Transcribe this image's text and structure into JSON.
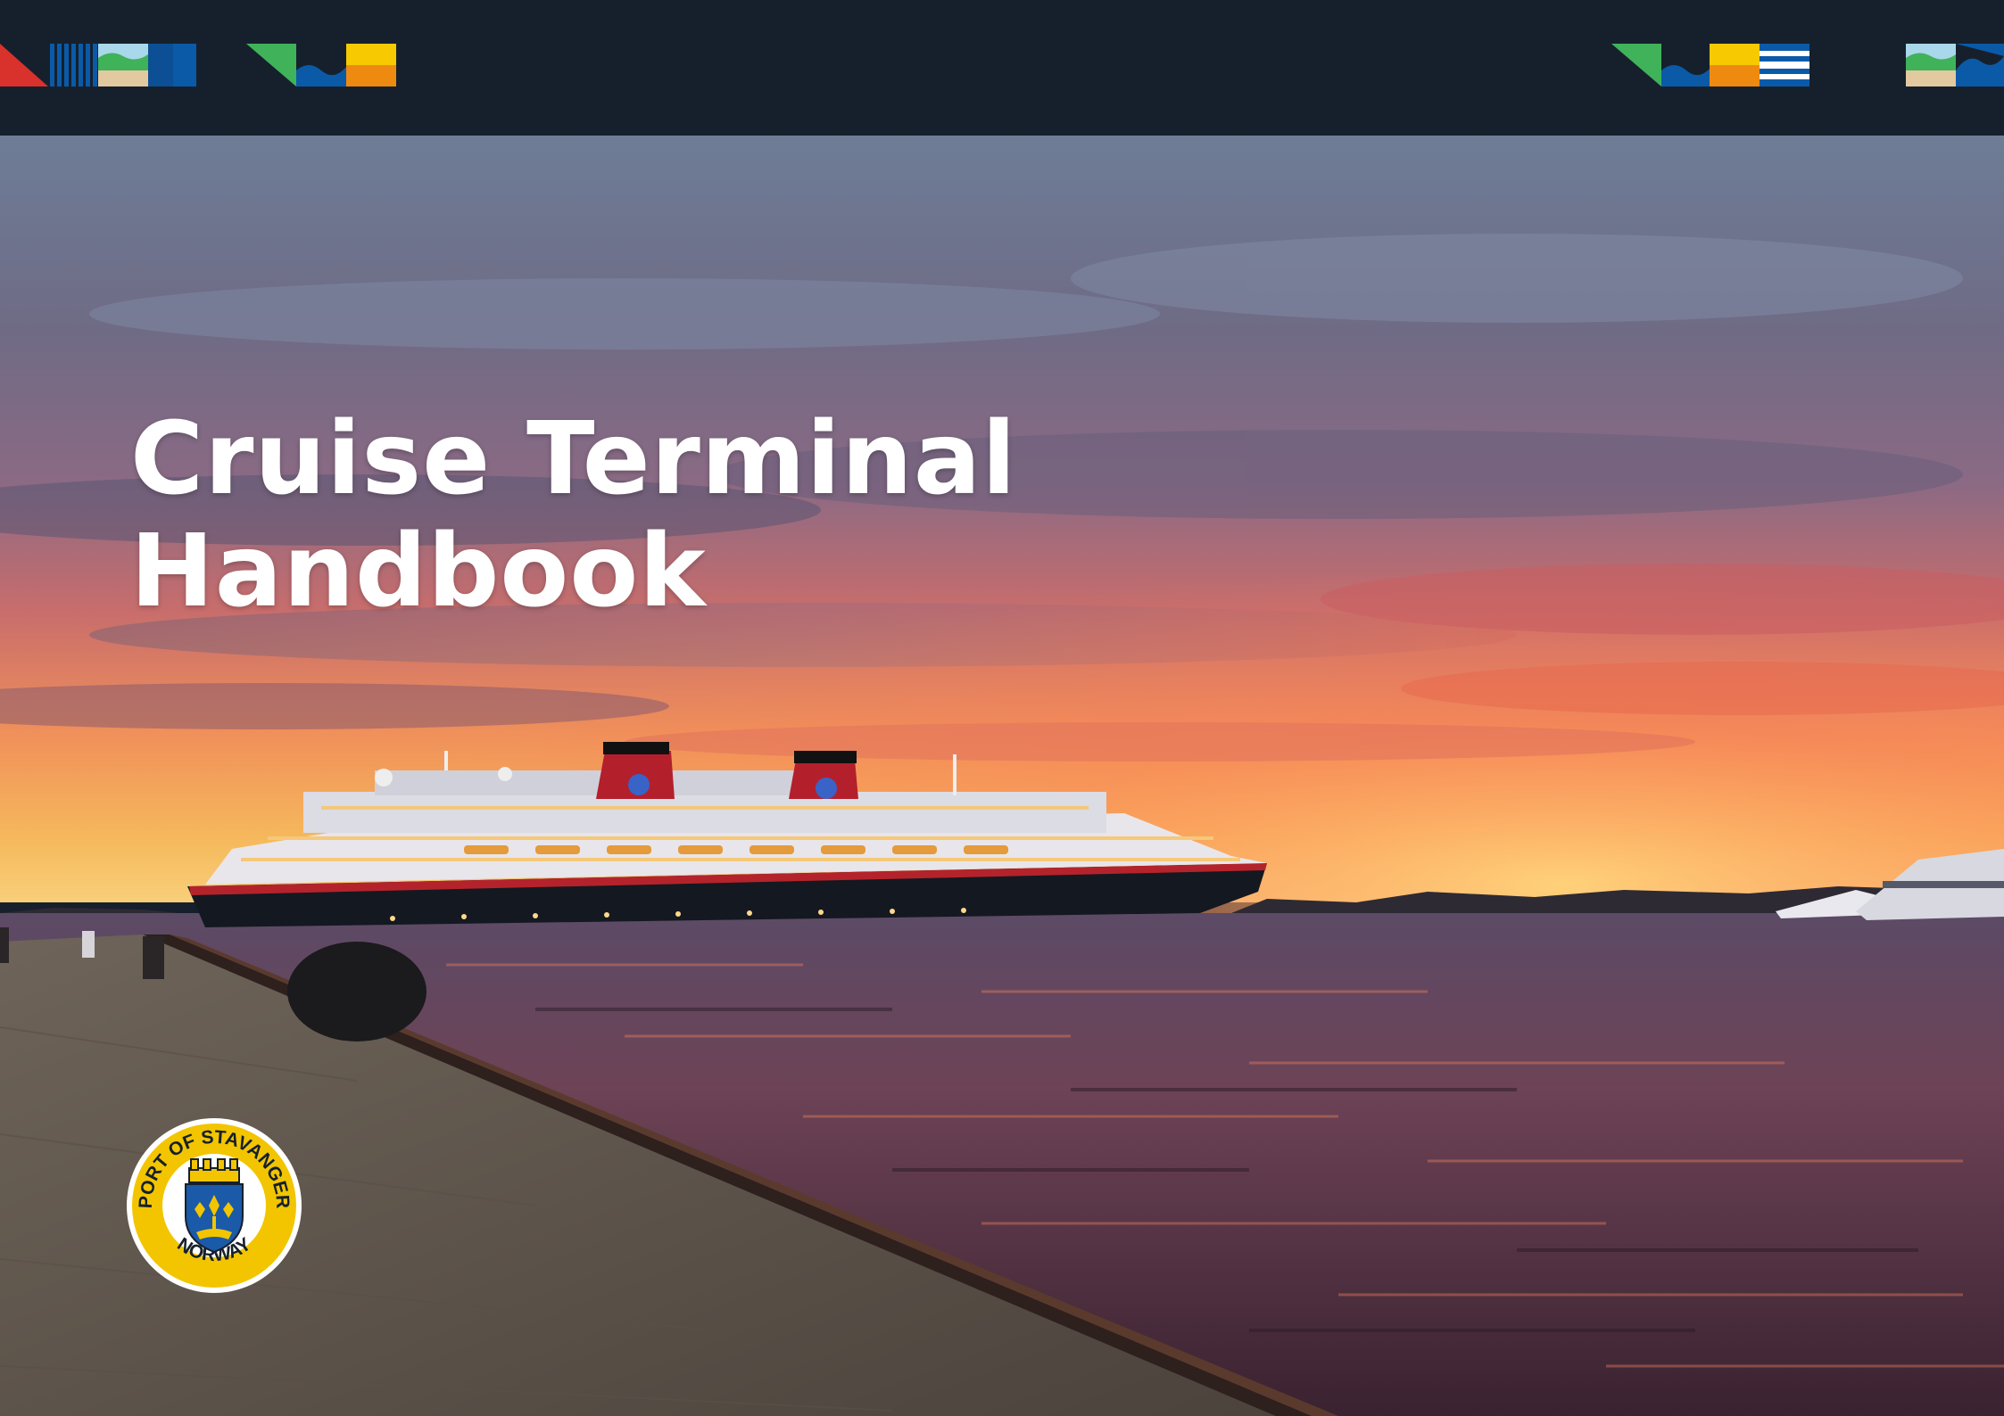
{
  "document": {
    "title_line_1": "Cruise Terminal",
    "title_line_2": "Handbook"
  },
  "logo": {
    "text_top": "PORT OF STAVANGER",
    "text_bottom": "NORWAY"
  },
  "colors": {
    "top_bar": "#16202c",
    "red": "#d9312b",
    "blue": "#0a5aa8",
    "green": "#3fb25a",
    "yellow": "#f7c900",
    "orange": "#ef8a11",
    "sand": "#e3c9a0",
    "sky": "#a8d8ea",
    "logo_ring": "#f2c500"
  }
}
